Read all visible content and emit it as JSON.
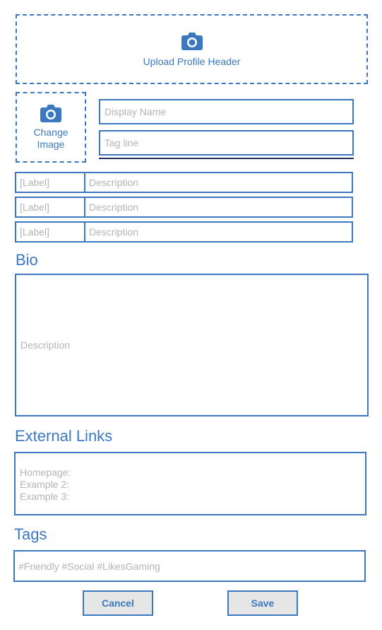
{
  "colors": {
    "accent": "#3c78c0",
    "placeholder": "#b4b4b4",
    "button_bg": "#e6e6e6",
    "underline": "#1f2f5a"
  },
  "header_upload": {
    "icon": "camera-icon",
    "label": "Upload Profile Header"
  },
  "avatar_upload": {
    "icon": "camera-icon",
    "label_line1": "Change",
    "label_line2": "Image"
  },
  "profile": {
    "display_name_placeholder": "Display Name",
    "display_name_value": "",
    "tag_line_placeholder": "Tag line",
    "tag_line_value": ""
  },
  "fields": [
    {
      "label": "[Label]",
      "description": "Description"
    },
    {
      "label": "[Label]",
      "description": "Description"
    },
    {
      "label": "[Label]",
      "description": "Description"
    }
  ],
  "bio": {
    "title": "Bio",
    "placeholder": "Description"
  },
  "external_links": {
    "title": "External Links",
    "lines": [
      "Homepage:",
      "Example 2:",
      "Example 3:"
    ]
  },
  "tags": {
    "title": "Tags",
    "placeholder": "#Friendly #Social #LikesGaming"
  },
  "buttons": {
    "cancel": "Cancel",
    "save": "Save"
  }
}
